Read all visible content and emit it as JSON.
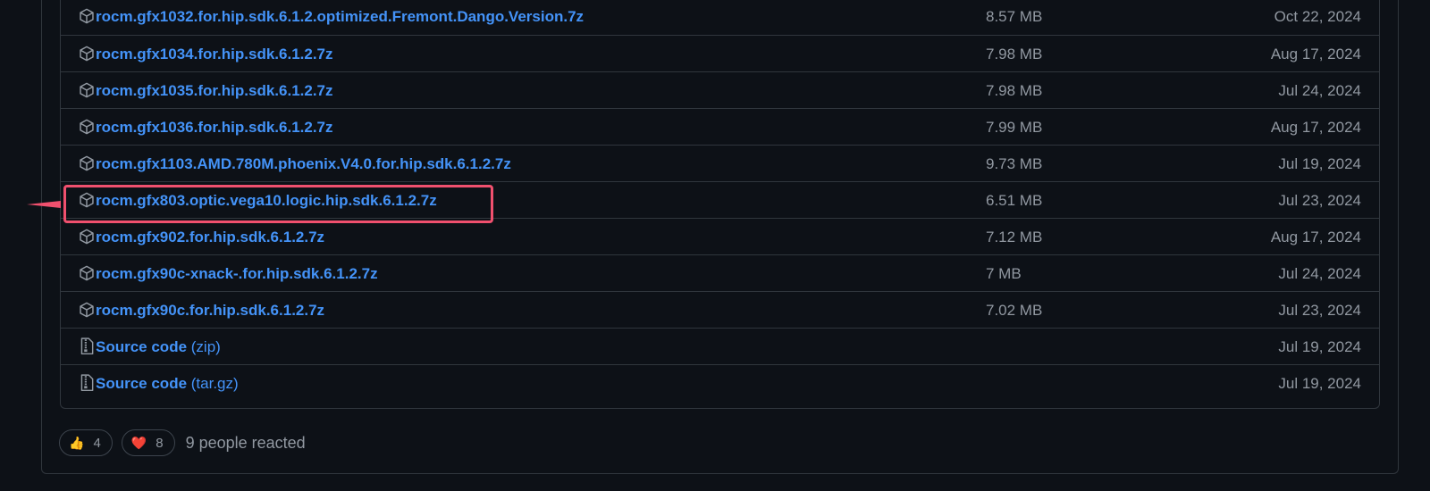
{
  "assets": [
    {
      "name": "rocm.gfx1032.for.hip.sdk.6.1.2.optimized.Fremont.Dango.Version.7z",
      "suffix": "",
      "size": "8.57 MB",
      "date": "Oct 22, 2024",
      "icon": "package-icon"
    },
    {
      "name": "rocm.gfx1034.for.hip.sdk.6.1.2.7z",
      "suffix": "",
      "size": "7.98 MB",
      "date": "Aug 17, 2024",
      "icon": "package-icon"
    },
    {
      "name": "rocm.gfx1035.for.hip.sdk.6.1.2.7z",
      "suffix": "",
      "size": "7.98 MB",
      "date": "Jul 24, 2024",
      "icon": "package-icon"
    },
    {
      "name": "rocm.gfx1036.for.hip.sdk.6.1.2.7z",
      "suffix": "",
      "size": "7.99 MB",
      "date": "Aug 17, 2024",
      "icon": "package-icon"
    },
    {
      "name": "rocm.gfx1103.AMD.780M.phoenix.V4.0.for.hip.sdk.6.1.2.7z",
      "suffix": "",
      "size": "9.73 MB",
      "date": "Jul 19, 2024",
      "icon": "package-icon"
    },
    {
      "name": "rocm.gfx803.optic.vega10.logic.hip.sdk.6.1.2.7z",
      "suffix": "",
      "size": "6.51 MB",
      "date": "Jul 23, 2024",
      "icon": "package-icon"
    },
    {
      "name": "rocm.gfx902.for.hip.sdk.6.1.2.7z",
      "suffix": "",
      "size": "7.12 MB",
      "date": "Aug 17, 2024",
      "icon": "package-icon"
    },
    {
      "name": "rocm.gfx90c-xnack-.for.hip.sdk.6.1.2.7z",
      "suffix": "",
      "size": "7 MB",
      "date": "Jul 24, 2024",
      "icon": "package-icon"
    },
    {
      "name": "rocm.gfx90c.for.hip.sdk.6.1.2.7z",
      "suffix": "",
      "size": "7.02 MB",
      "date": "Jul 23, 2024",
      "icon": "package-icon"
    },
    {
      "name": "Source code",
      "suffix": " (zip)",
      "size": "",
      "date": "Jul 19, 2024",
      "icon": "file-zip-icon"
    },
    {
      "name": "Source code",
      "suffix": " (tar.gz)",
      "size": "",
      "date": "Jul 19, 2024",
      "icon": "file-zip-icon"
    }
  ],
  "highlighted_asset_index": 5,
  "reactions": {
    "thumbs_up": {
      "emoji": "👍",
      "count": "4"
    },
    "heart": {
      "emoji": "❤️",
      "count": "8"
    },
    "summary": "9 people reacted"
  },
  "colors": {
    "background": "#0d1117",
    "border": "#30363d",
    "link": "#4493f8",
    "muted": "#9198a1",
    "highlight": "#f0506e"
  }
}
